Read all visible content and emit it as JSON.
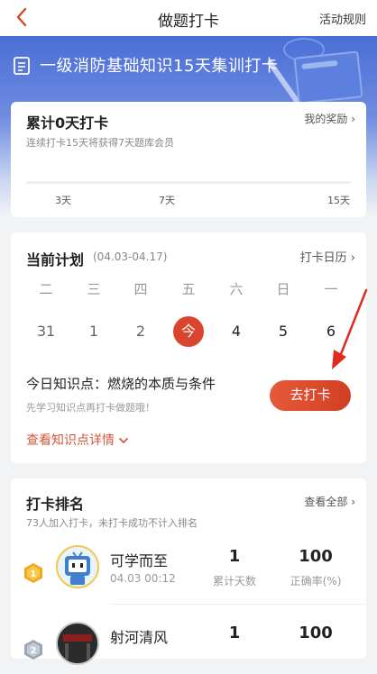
{
  "nav": {
    "title": "做题打卡",
    "rule": "活动规则"
  },
  "banner": {
    "title": "一级消防基础知识15天集训打卡"
  },
  "streak": {
    "title": "累计0天打卡",
    "subtitle": "连续打卡15天将获得7天题库会员",
    "reward": "我的奖励",
    "ticks": [
      "3天",
      "7天",
      "15天"
    ],
    "progress": 0
  },
  "plan": {
    "title": "当前计划",
    "range": "(04.03-04.17)",
    "calendar_link": "打卡日历",
    "weekdays": [
      "二",
      "三",
      "四",
      "五",
      "六",
      "日",
      "一"
    ],
    "dates": [
      "31",
      "1",
      "2",
      "今",
      "4",
      "5",
      "6"
    ],
    "today_point": "今日知识点：燃烧的本质与条件",
    "today_hint": "先学习知识点再打卡做题哦！",
    "checkin_button": "去打卡",
    "detail_link": "查看知识点详情"
  },
  "ranking": {
    "title": "打卡排名",
    "subtitle": "73人加入打卡，未打卡成功不计入排名",
    "view_all": "查看全部",
    "rows": [
      {
        "rank": "1",
        "name": "可学而至",
        "time": "04.03 00:12",
        "days": "1",
        "days_label": "累计天数",
        "accuracy": "100",
        "accuracy_label": "正确率(%)"
      },
      {
        "rank": "2",
        "name": "射河清风",
        "time": "",
        "days": "1",
        "days_label": "",
        "accuracy": "100",
        "accuracy_label": ""
      }
    ]
  },
  "colors": {
    "accent": "#d9442d",
    "banner": "#4a6ed6"
  },
  "icons": [
    "back-icon",
    "doc-icon",
    "chevron-right-icon",
    "chevron-down-icon",
    "gold-medal-icon",
    "silver-medal-icon",
    "annotation-arrow"
  ]
}
